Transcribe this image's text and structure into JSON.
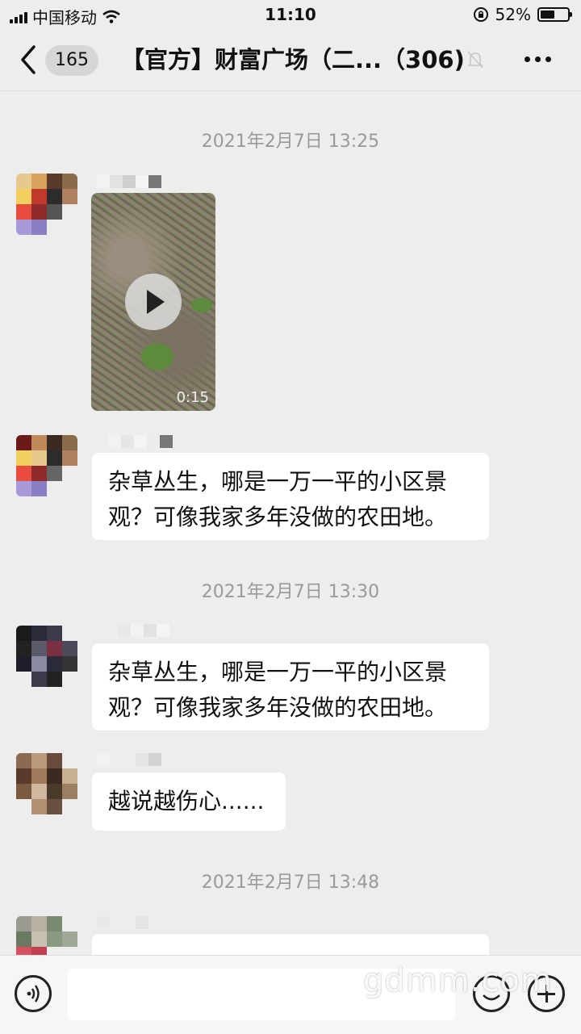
{
  "status_bar": {
    "carrier": "中国移动",
    "time": "11:10",
    "battery": "52%",
    "battery_level": 0.52
  },
  "navbar": {
    "unread_count": "165",
    "title": "【官方】财富广场（二...（306)"
  },
  "messages": [
    {
      "type": "timestamp",
      "text": "2021年2月7日 13:25"
    },
    {
      "type": "video",
      "duration": "0:15"
    },
    {
      "type": "text",
      "text": "杂草丛生，哪是一万一平的小区景观？可像我家多年没做的农田地。"
    },
    {
      "type": "timestamp",
      "text": "2021年2月7日 13:30"
    },
    {
      "type": "text",
      "text": "杂草丛生，哪是一万一平的小区景观？可像我家多年没做的农田地。"
    },
    {
      "type": "text",
      "text": "越说越伤心......"
    },
    {
      "type": "timestamp",
      "text": "2021年2月7日 13:48"
    }
  ],
  "watermark": "gdmm.com",
  "colors": {
    "background": "#ededed",
    "bubble": "#ffffff",
    "timestamp": "#9a9a9a"
  }
}
